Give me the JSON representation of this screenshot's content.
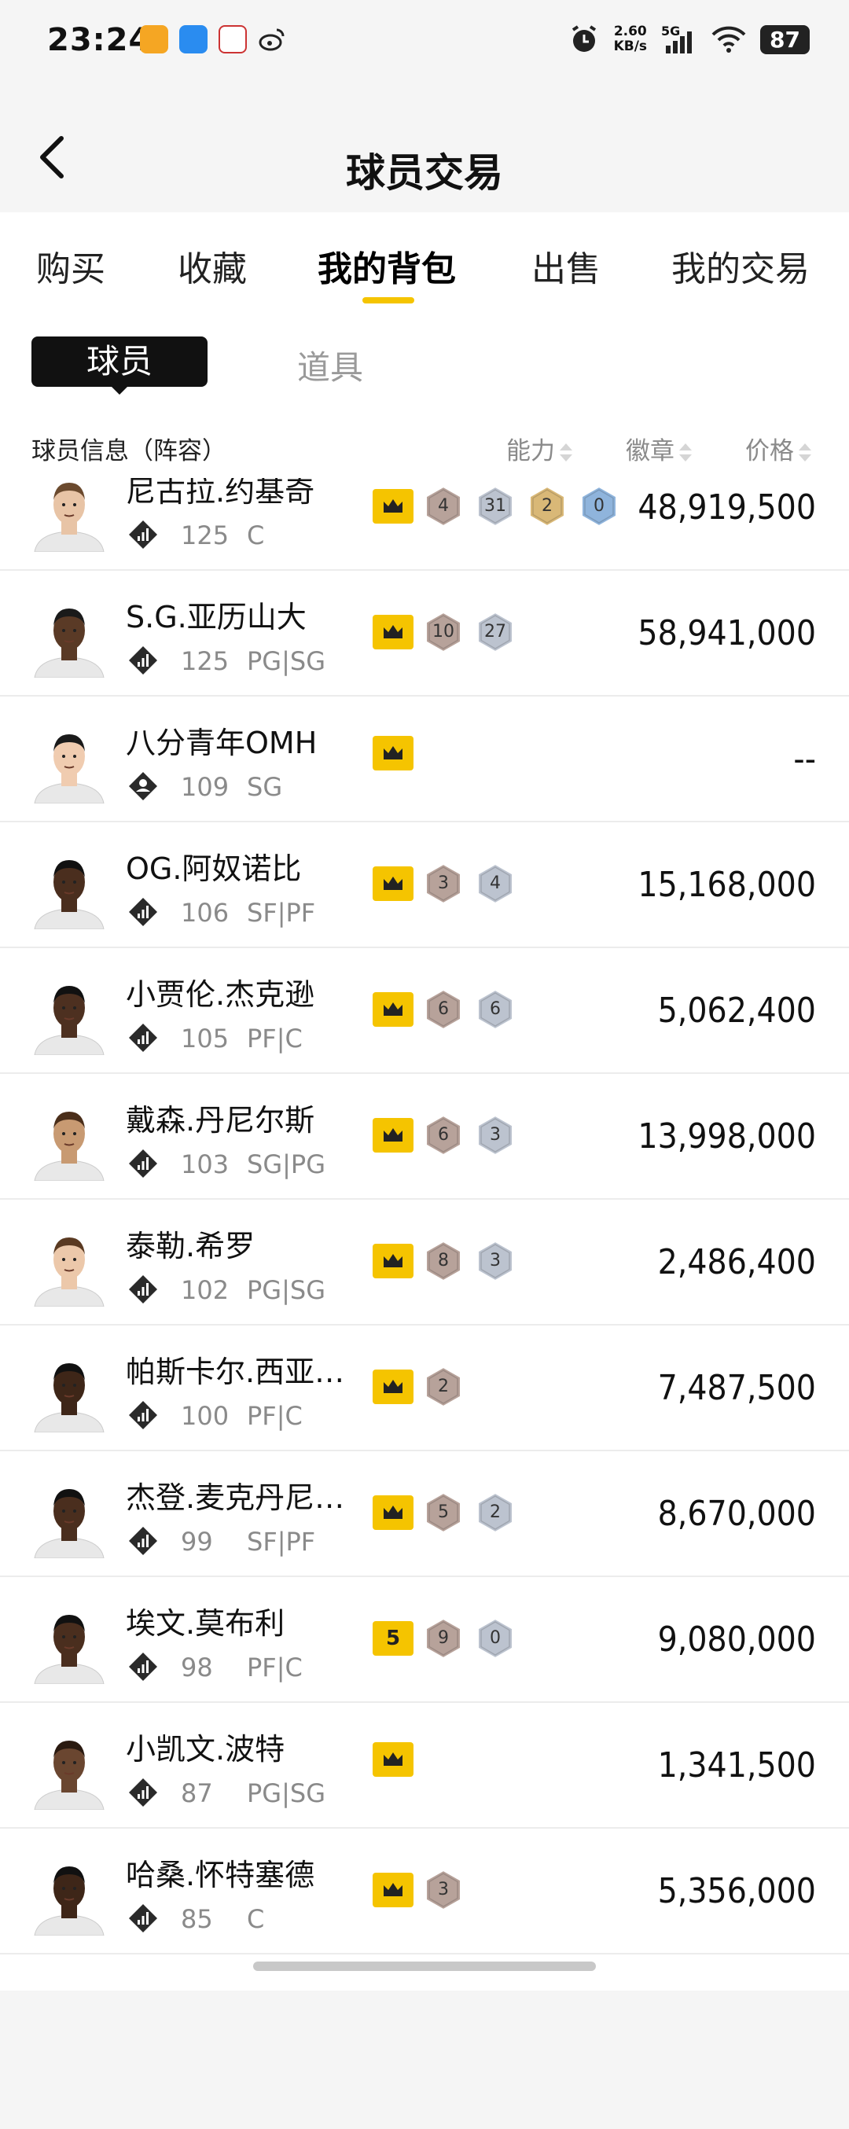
{
  "status_bar": {
    "time": "23:24",
    "speed_value": "2.60",
    "speed_unit": "KB/s",
    "network": "5G",
    "battery": "87"
  },
  "header": {
    "title": "球员交易"
  },
  "tabs": [
    {
      "label": "购买",
      "active": false
    },
    {
      "label": "收藏",
      "active": false
    },
    {
      "label": "我的背包",
      "active": true
    },
    {
      "label": "出售",
      "active": false
    },
    {
      "label": "我的交易",
      "active": false
    }
  ],
  "subtabs": {
    "active": "球员",
    "other": "道具"
  },
  "columns": {
    "info": "球员信息（阵容）",
    "ability": "能力",
    "badges": "徽章",
    "price": "价格"
  },
  "players": [
    {
      "name": "尼古拉.约基奇",
      "rating": "125",
      "pos": "C",
      "crown": "crown",
      "hexes": [
        {
          "n": "4",
          "t": "bronze"
        },
        {
          "n": "31",
          "t": "silver"
        },
        {
          "n": "2",
          "t": "gold"
        },
        {
          "n": "0",
          "t": "blue"
        }
      ],
      "price": "48,919,500",
      "skin": "#e8c4a6",
      "hair": "#6b4a2e"
    },
    {
      "name": "S.G.亚历山大",
      "rating": "125",
      "pos": "PG|SG",
      "crown": "crown",
      "hexes": [
        {
          "n": "10",
          "t": "bronze"
        },
        {
          "n": "27",
          "t": "silver"
        }
      ],
      "price": "58,941,000",
      "skin": "#5a3a26",
      "hair": "#1a1a1a"
    },
    {
      "name": "八分青年OMH",
      "rating": "109",
      "pos": "SG",
      "crown": "crown",
      "hexes": [],
      "price": "--",
      "skin": "#f0ccb0",
      "hair": "#1a1a1a",
      "user_icon": true
    },
    {
      "name": "OG.阿奴诺比",
      "rating": "106",
      "pos": "SF|PF",
      "crown": "crown",
      "hexes": [
        {
          "n": "3",
          "t": "bronze"
        },
        {
          "n": "4",
          "t": "silver"
        }
      ],
      "price": "15,168,000",
      "skin": "#4a2e1e",
      "hair": "#111"
    },
    {
      "name": "小贾伦.杰克逊",
      "rating": "105",
      "pos": "PF|C",
      "crown": "crown",
      "hexes": [
        {
          "n": "6",
          "t": "bronze"
        },
        {
          "n": "6",
          "t": "silver"
        }
      ],
      "price": "5,062,400",
      "skin": "#4d3020",
      "hair": "#111"
    },
    {
      "name": "戴森.丹尼尔斯",
      "rating": "103",
      "pos": "SG|PG",
      "crown": "crown",
      "hexes": [
        {
          "n": "6",
          "t": "bronze"
        },
        {
          "n": "3",
          "t": "silver"
        }
      ],
      "price": "13,998,000",
      "skin": "#c89a72",
      "hair": "#4a2e1a"
    },
    {
      "name": "泰勒.希罗",
      "rating": "102",
      "pos": "PG|SG",
      "crown": "crown",
      "hexes": [
        {
          "n": "8",
          "t": "bronze"
        },
        {
          "n": "3",
          "t": "silver"
        }
      ],
      "price": "2,486,400",
      "skin": "#ecc8aa",
      "hair": "#5a3a22"
    },
    {
      "name": "帕斯卡尔.西亚…",
      "rating": "100",
      "pos": "PF|C",
      "crown": "crown",
      "hexes": [
        {
          "n": "2",
          "t": "bronze"
        }
      ],
      "price": "7,487,500",
      "skin": "#3e2618",
      "hair": "#111"
    },
    {
      "name": "杰登.麦克丹尼…",
      "rating": "99",
      "pos": "SF|PF",
      "crown": "crown",
      "hexes": [
        {
          "n": "5",
          "t": "bronze"
        },
        {
          "n": "2",
          "t": "silver"
        }
      ],
      "price": "8,670,000",
      "skin": "#4a2e1e",
      "hair": "#111"
    },
    {
      "name": "埃文.莫布利",
      "rating": "98",
      "pos": "PF|C",
      "crown": "5",
      "hexes": [
        {
          "n": "9",
          "t": "bronze"
        },
        {
          "n": "0",
          "t": "silver"
        }
      ],
      "price": "9,080,000",
      "skin": "#4a2e1e",
      "hair": "#111"
    },
    {
      "name": "小凯文.波特",
      "rating": "87",
      "pos": "PG|SG",
      "crown": "crown",
      "hexes": [],
      "price": "1,341,500",
      "skin": "#6a4630",
      "hair": "#2a1a10"
    },
    {
      "name": "哈桑.怀特塞德",
      "rating": "85",
      "pos": "C",
      "crown": "crown",
      "hexes": [
        {
          "n": "3",
          "t": "bronze"
        }
      ],
      "price": "5,356,000",
      "skin": "#3e2618",
      "hair": "#111"
    }
  ],
  "colors": {
    "accent_yellow": "#f5c400",
    "bronze": "#b7a29a",
    "silver": "#bcc3cf",
    "gold": "#d9b877",
    "blue": "#8fb4dc"
  }
}
